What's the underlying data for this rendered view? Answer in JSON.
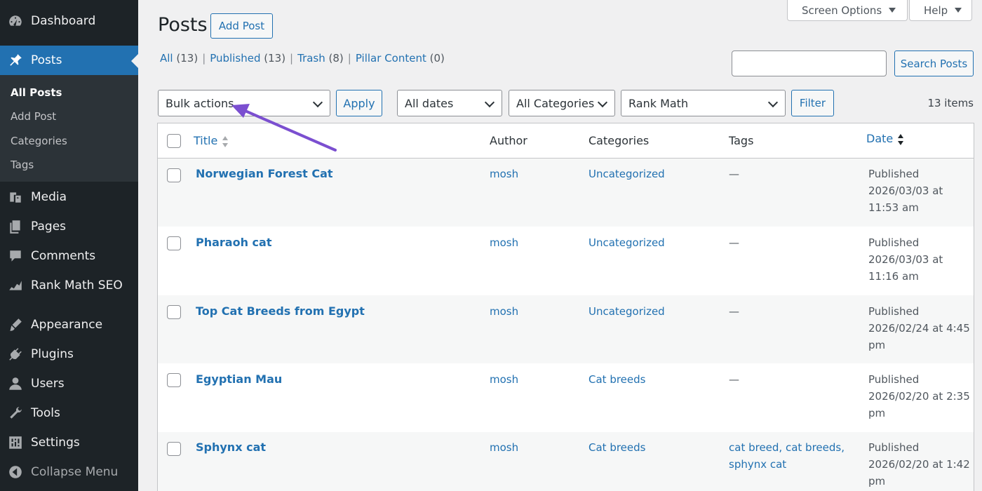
{
  "sidebar": {
    "items": [
      {
        "label": "Dashboard",
        "icon": "dashboard-icon"
      },
      {
        "label": "Posts",
        "icon": "pin-icon"
      },
      {
        "label": "Media",
        "icon": "media-icon"
      },
      {
        "label": "Pages",
        "icon": "pages-icon"
      },
      {
        "label": "Comments",
        "icon": "comments-icon"
      },
      {
        "label": "Rank Math SEO",
        "icon": "rank-math-icon"
      },
      {
        "label": "Appearance",
        "icon": "appearance-icon"
      },
      {
        "label": "Plugins",
        "icon": "plugins-icon"
      },
      {
        "label": "Users",
        "icon": "users-icon"
      },
      {
        "label": "Tools",
        "icon": "tools-icon"
      },
      {
        "label": "Settings",
        "icon": "settings-icon"
      },
      {
        "label": "Collapse Menu",
        "icon": "collapse-icon"
      }
    ],
    "submenu": [
      "All Posts",
      "Add Post",
      "Categories",
      "Tags"
    ]
  },
  "header": {
    "title": "Posts",
    "add_button": "Add Post",
    "screen_options": "Screen Options",
    "help": "Help"
  },
  "filters_links": [
    {
      "label": "All",
      "count": "(13)"
    },
    {
      "label": "Published",
      "count": "(13)"
    },
    {
      "label": "Trash",
      "count": "(8)"
    },
    {
      "label": "Pillar Content",
      "count": "(0)"
    }
  ],
  "search": {
    "button": "Search Posts",
    "value": ""
  },
  "toolbar": {
    "bulk_actions": "Bulk actions",
    "apply": "Apply",
    "dates": "All dates",
    "categories": "All Categories",
    "rank_math": "Rank Math",
    "filter": "Filter",
    "items_count": "13 items"
  },
  "table": {
    "columns": {
      "title": "Title",
      "author": "Author",
      "categories": "Categories",
      "tags": "Tags",
      "date": "Date"
    },
    "rows": [
      {
        "title": "Norwegian Forest Cat",
        "author": "mosh",
        "categories": "Uncategorized",
        "tags": "—",
        "date": [
          "Published",
          "2026/03/03 at",
          "11:53 am"
        ]
      },
      {
        "title": "Pharaoh cat",
        "author": "mosh",
        "categories": "Uncategorized",
        "tags": "—",
        "date": [
          "Published",
          "2026/03/03 at",
          "11:16 am"
        ]
      },
      {
        "title": "Top Cat Breeds from Egypt",
        "author": "mosh",
        "categories": "Uncategorized",
        "tags": "—",
        "date": [
          "Published",
          "2026/02/24 at 4:45",
          "pm"
        ]
      },
      {
        "title": "Egyptian Mau",
        "author": "mosh",
        "categories": "Cat breeds",
        "tags": "—",
        "date": [
          "Published",
          "2026/02/20 at 2:35",
          "pm"
        ]
      },
      {
        "title": "Sphynx cat",
        "author": "mosh",
        "categories": "Cat breeds",
        "tags": "cat breed, cat breeds,\nsphynx cat",
        "tags_lines": [
          "cat breed, cat breeds,",
          "sphynx cat"
        ],
        "date": [
          "Published",
          "2026/02/20 at 1:42",
          "pm"
        ]
      }
    ]
  },
  "colors": {
    "accent": "#2271b1",
    "sidebar": "#1d2327",
    "annotation_arrow": "#7b4fd0"
  }
}
